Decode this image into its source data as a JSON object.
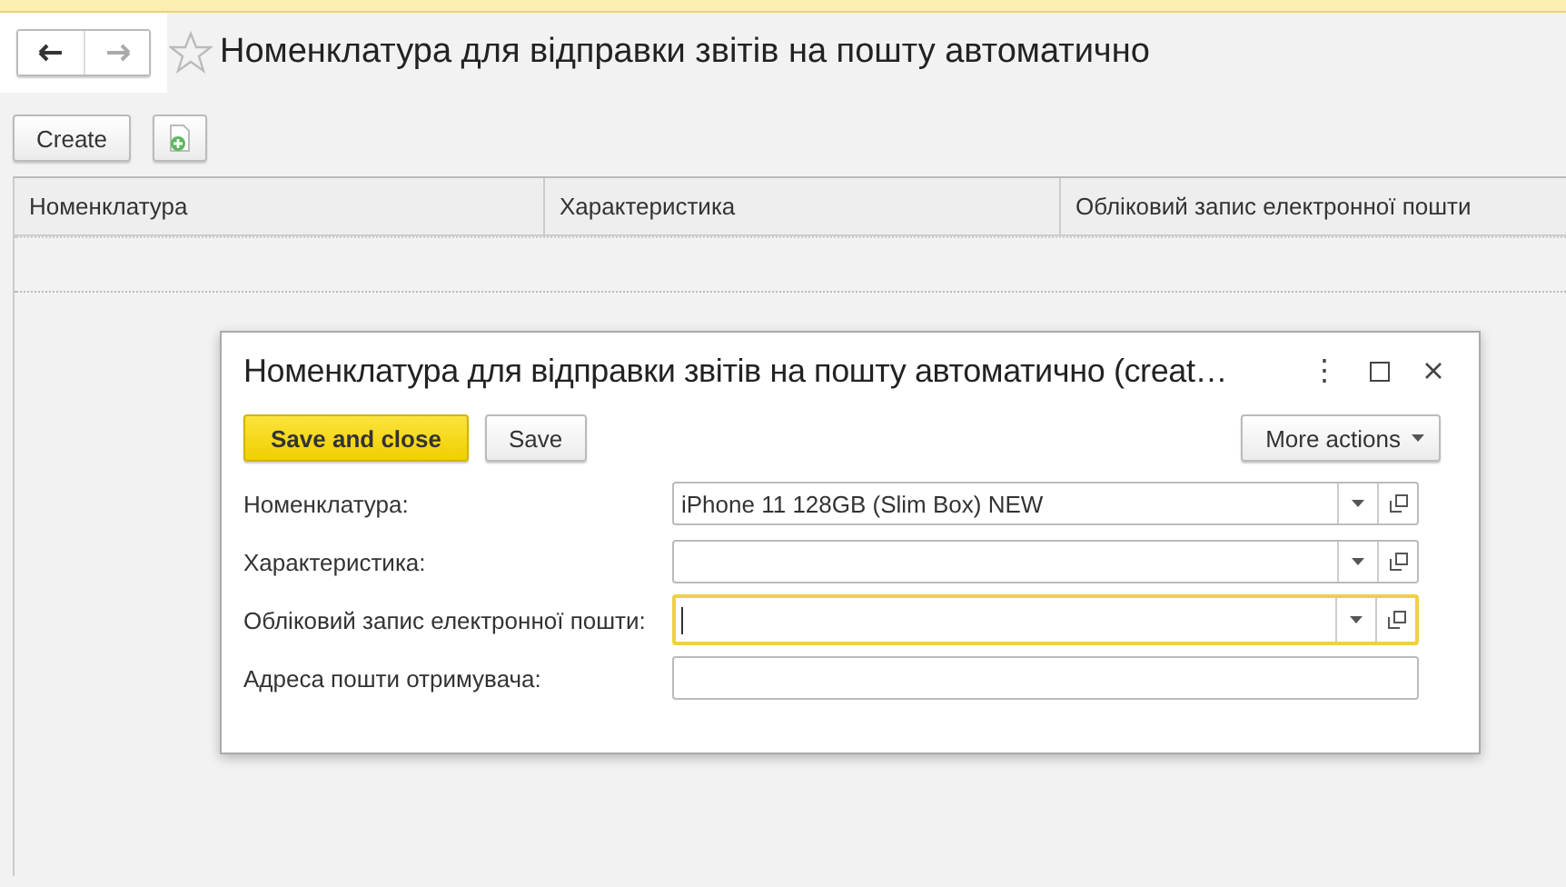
{
  "page": {
    "title": "Номенклатура для відправки звітів на пошту автоматично",
    "favorite": false
  },
  "toolbar": {
    "create_label": "Create"
  },
  "table": {
    "columns": [
      "Номенклатура",
      "Характеристика",
      "Обліковий запис електронної пошти"
    ]
  },
  "dialog": {
    "title": "Номенклатура для відправки звітів на пошту автоматично (creat…",
    "menu_glyph": "⋮",
    "buttons": [
      {
        "label": "Save and close",
        "kind": "primary"
      },
      {
        "label": "Save",
        "kind": "plain"
      }
    ],
    "more_actions": "More actions",
    "fields": [
      {
        "label": "Номенклатура:",
        "value": "iPhone 11 128GB (Slim Box) NEW",
        "kind": "select",
        "focused": false
      },
      {
        "label": "Характеристика:",
        "kind": "select",
        "focused": false
      },
      {
        "label": "Обліковий запис електронної пошти:",
        "kind": "select",
        "focused": true
      },
      {
        "label": "Адреса пошти отримувача:",
        "kind": "text",
        "focused": false
      }
    ]
  }
}
